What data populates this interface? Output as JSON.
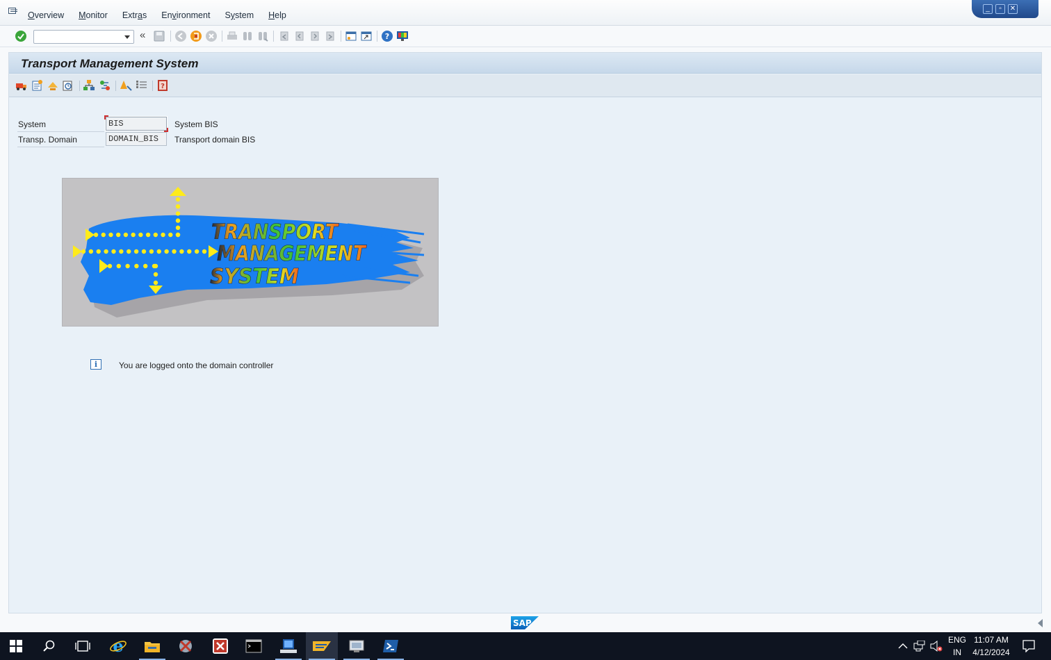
{
  "menubar": {
    "items": [
      {
        "label": "Overview",
        "underline_index": 0
      },
      {
        "label": "Monitor",
        "underline_index": 0
      },
      {
        "label": "Extras",
        "underline_index": 4
      },
      {
        "label": "Environment",
        "underline_index": 2
      },
      {
        "label": "System",
        "underline_index": 1
      },
      {
        "label": "Help",
        "underline_index": 0
      }
    ]
  },
  "window_controls": {
    "minimize": "minimize",
    "restore": "restore",
    "close": "close"
  },
  "system_toolbar": {
    "command_field_value": "",
    "icons": [
      "enter-icon",
      "back-arrows-icon",
      "save-icon",
      "back-icon",
      "exit-icon",
      "cancel-icon",
      "print-icon",
      "find-icon",
      "find-next-icon",
      "first-page-icon",
      "previous-page-icon",
      "next-page-icon",
      "last-page-icon",
      "create-session-icon",
      "shortcut-icon",
      "help-icon",
      "customize-layout-icon"
    ]
  },
  "title": "Transport Management System",
  "app_toolbar": {
    "icons": [
      "transport-routes-icon",
      "system-overview-icon",
      "import-overview-icon",
      "tms-alert-icon",
      "transport-domain-icon",
      "transport-layers-icon",
      "qa-approval-icon",
      "settings-list-icon",
      "help-docu-icon"
    ]
  },
  "fields": {
    "system": {
      "label": "System",
      "value": "BIS",
      "description": "System BIS"
    },
    "domain": {
      "label": "Transp. Domain",
      "value": "DOMAIN_BIS",
      "description": "Transport domain BIS"
    }
  },
  "logo": {
    "line1": "TRANSPORT",
    "line2": "MANAGEMENT",
    "line3": "SYSTEM"
  },
  "message": {
    "icon": "info-icon",
    "text": "You are logged onto the domain controller"
  },
  "footer": {
    "brand": "SAP"
  },
  "taskbar": {
    "apps": [
      "start-icon",
      "search-icon",
      "task-view-icon",
      "internet-explorer-icon",
      "file-explorer-icon",
      "tool-icon",
      "sap-logon-icon",
      "command-prompt-icon",
      "server-manager-icon",
      "sap-gui-icon",
      "remote-app-icon",
      "powershell-icon"
    ],
    "language": "ENG",
    "region": "IN",
    "time": "11:07 AM",
    "date": "4/12/2024"
  },
  "colors": {
    "accent": "#2f6fb4",
    "title_bar": "#c6d8ea",
    "content_bg": "#e9f1f8",
    "taskbar": "#0e1420",
    "logo_blue": "#1a7ff0",
    "logo_yellow": "#ffeb1a"
  }
}
